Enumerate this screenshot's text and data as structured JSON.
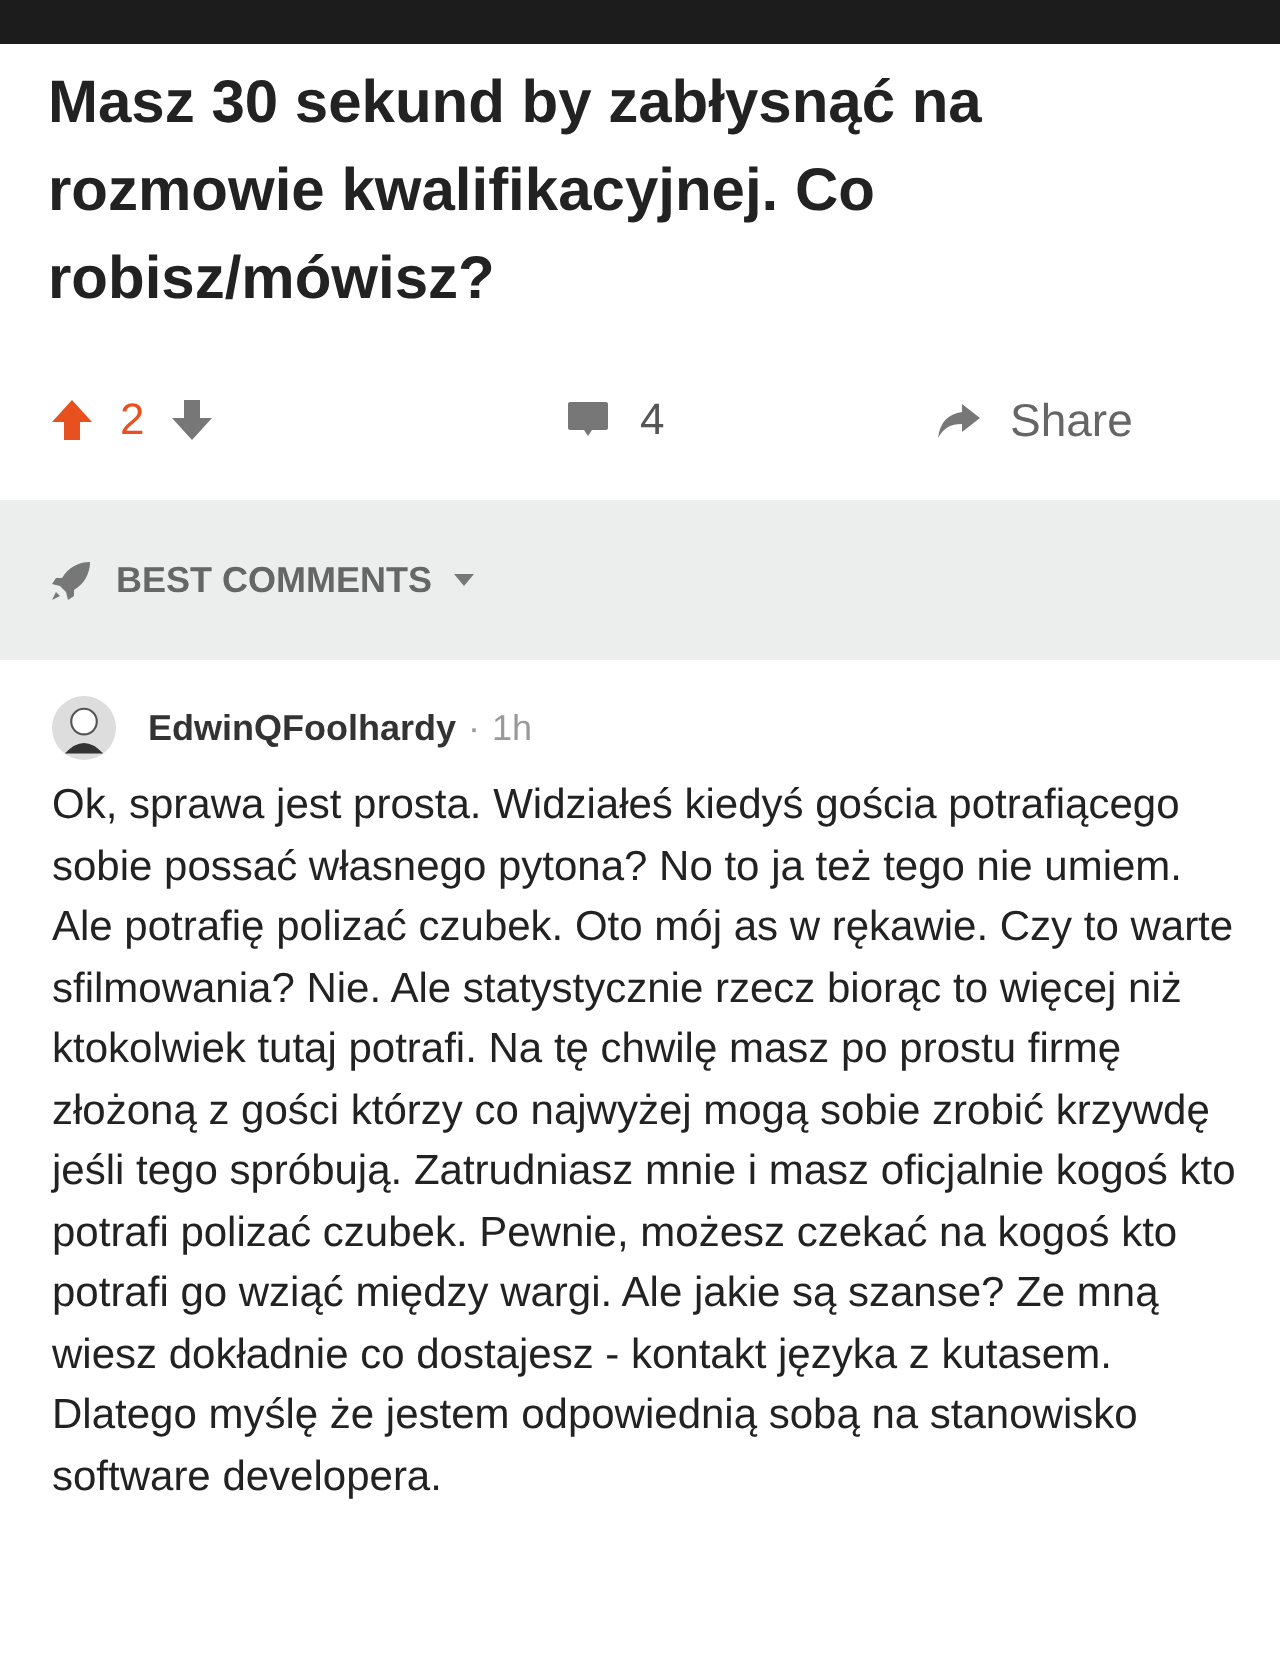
{
  "post": {
    "title": "Masz 30 sekund by zabłysnąć na rozmowie kwalifikacyjnej. Co robisz/mówisz?"
  },
  "actions": {
    "upvoted": true,
    "downvoted": false,
    "score": "2",
    "comments": "4",
    "share": "Share"
  },
  "comments_header": {
    "sort": "BEST COMMENTS"
  },
  "comment": {
    "author": "EdwinQFoolhardy",
    "separator": "·",
    "time": "1h",
    "text": "Ok, sprawa jest prosta. Widziałeś kiedyś gościa potrafiącego sobie possać własnego pytona? No to ja też tego nie umiem. Ale potrafię polizać czubek. Oto mój as w rękawie. Czy to warte sfilmowania? Nie. Ale statystycznie rzecz biorąc to więcej niż ktokolwiek tutaj potrafi. Na tę chwilę masz po prostu firmę złożoną z gości którzy co najwyżej mogą sobie zrobić krzywdę jeśli tego spróbują. Zatrudniasz mnie i masz oficjalnie kogoś kto potrafi polizać czubek. Pewnie, możesz czekać na kogoś kto potrafi go wziąć między wargi. Ale jakie są szanse? Ze mną wiesz dokładnie co dostajesz - kontakt języka z kutasem. Dlatego myślę że jestem odpowiednią sobą na stanowisko software developera."
  }
}
